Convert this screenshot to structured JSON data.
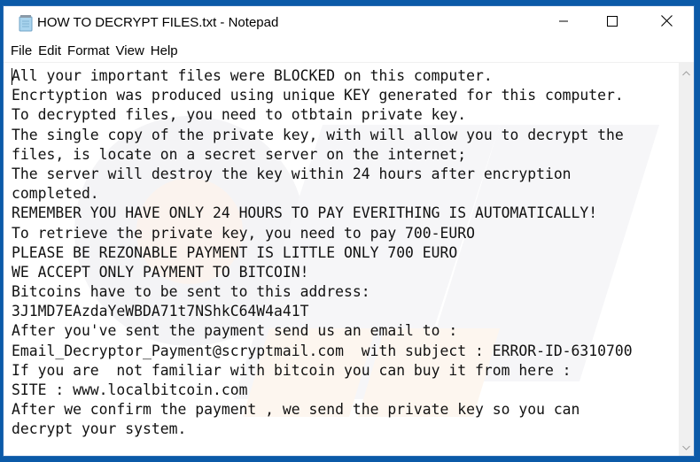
{
  "window": {
    "title": "HOW TO DECRYPT FILES.txt - Notepad",
    "app_icon": "notepad-icon",
    "controls": {
      "minimize": "minimize-icon",
      "maximize": "maximize-icon",
      "close": "close-icon"
    }
  },
  "menubar": {
    "items": [
      {
        "label": "File"
      },
      {
        "label": "Edit"
      },
      {
        "label": "Format"
      },
      {
        "label": "View"
      },
      {
        "label": "Help"
      }
    ]
  },
  "document": {
    "lines": [
      "All your important files were BLOCKED on this computer.",
      "Encrtyption was produced using unique KEY generated for this computer.",
      "To decrypted files, you need to otbtain private key.",
      "The single copy of the private key, with will allow you to decrypt the",
      "files, is locate on a secret server on the internet;",
      "The server will destroy the key within 24 hours after encryption",
      "completed.",
      "REMEMBER YOU HAVE ONLY 24 HOURS TO PAY EVERITHING IS AUTOMATICALLY!",
      "To retrieve the private key, you need to pay 700-EURO",
      "PLEASE BE REZONABLE PAYMENT IS LITTLE ONLY 700 EURO",
      "WE ACCEPT ONLY PAYMENT TO BITCOIN!",
      "Bitcoins have to be sent to this address:",
      "3J1MD7EAzdaYeWBDA71t7NShkC64W4a41T",
      "After you've sent the payment send us an email to :",
      "Email_Decryptor_Payment@scryptmail.com  with subject : ERROR-ID-6310700",
      "If you are  not familiar with bitcoin you can buy it from here :",
      "SITE : www.localbitcoin.com",
      "After we confirm the payment , we send the private key so you can",
      "decrypt your system."
    ]
  },
  "scrollbar": {
    "up_icon": "chevron-up-icon",
    "down_icon": "chevron-down-icon"
  },
  "colors": {
    "desktop": "#0b5aa8",
    "window_bg": "#ffffff",
    "text": "#111111"
  }
}
